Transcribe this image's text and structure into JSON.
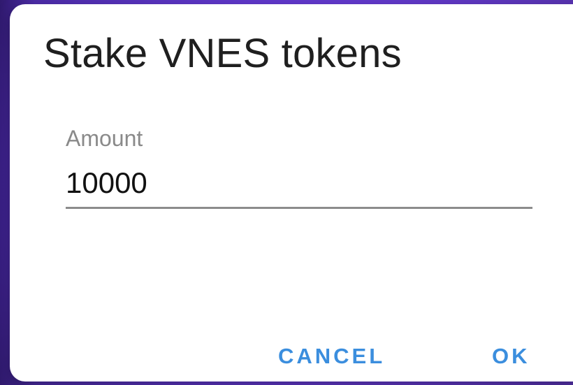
{
  "dialog": {
    "title": "Stake VNES tokens",
    "amount_field": {
      "label": "Amount",
      "value": "10000",
      "placeholder": ""
    },
    "actions": {
      "cancel_label": "CANCEL",
      "ok_label": "OK"
    }
  },
  "theme": {
    "backdrop_color": "#6c3fd9",
    "accent_color": "#3b8ede",
    "title_color": "#1f1f1f",
    "label_color": "#8a8a8a"
  },
  "icons": {
    "side_toggle": "toggle-switch-icon"
  }
}
